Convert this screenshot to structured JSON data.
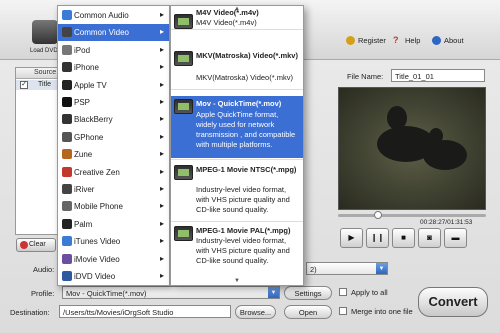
{
  "toolbar": {
    "load_label": "Load DVD",
    "register_label": "Register",
    "help_label": "Help",
    "about_label": "About"
  },
  "file_list": {
    "column_source": "Source",
    "row_title": "Title"
  },
  "clear_label": "Clear",
  "preview": {
    "file_name_label": "File Name:",
    "file_name_value": "Title_01_01",
    "time": "00:28:27/01:31:53"
  },
  "form": {
    "audio_label": "Audio:",
    "audio_value_partial": "2)",
    "profile_label": "Profile:",
    "profile_value": "Mov - QuickTime(*.mov)",
    "settings_label": "Settings",
    "apply_all_label": "Apply to all",
    "destination_label": "Destination:",
    "destination_value": "/Users/tts/Movies/iOrgSoft Studio",
    "browse_label": "Browse...",
    "open_label": "Open",
    "merge_label": "Merge into one file",
    "convert_label": "Convert"
  },
  "categories": [
    {
      "label": "Common Audio",
      "icon": "music-note-icon",
      "color": "#3a7bd5"
    },
    {
      "label": "Common Video",
      "icon": "film-icon",
      "color": "#444444",
      "selected": true
    },
    {
      "label": "iPod",
      "icon": "ipod-icon",
      "color": "#777777"
    },
    {
      "label": "iPhone",
      "icon": "iphone-icon",
      "color": "#333333"
    },
    {
      "label": "Apple TV",
      "icon": "apple-tv-icon",
      "color": "#222222"
    },
    {
      "label": "PSP",
      "icon": "psp-icon",
      "color": "#111111"
    },
    {
      "label": "BlackBerry",
      "icon": "blackberry-icon",
      "color": "#333333"
    },
    {
      "label": "GPhone",
      "icon": "gphone-icon",
      "color": "#555555"
    },
    {
      "label": "Zune",
      "icon": "zune-icon",
      "color": "#b5651d"
    },
    {
      "label": "Creative Zen",
      "icon": "creative-zen-icon",
      "color": "#c0392b"
    },
    {
      "label": "iRiver",
      "icon": "iriver-icon",
      "color": "#444444"
    },
    {
      "label": "Mobile Phone",
      "icon": "mobile-phone-icon",
      "color": "#666666"
    },
    {
      "label": "Palm",
      "icon": "palm-icon",
      "color": "#222222"
    },
    {
      "label": "iTunes Video",
      "icon": "itunes-icon",
      "color": "#3a7bd5"
    },
    {
      "label": "iMovie Video",
      "icon": "imovie-icon",
      "color": "#6a4fa0"
    },
    {
      "label": "iDVD Video",
      "icon": "idvd-icon",
      "color": "#2c5aa0"
    }
  ],
  "formats": [
    {
      "title": "M4V Video(*.m4v)",
      "lines": [
        "M4V Video(*.m4v)"
      ]
    },
    {
      "title": "MKV(Matroska) Video(*.mkv)",
      "lines": [
        "MKV(Matroska) Video(*.mkv)"
      ]
    },
    {
      "title": "Mov - QuickTime(*.mov)",
      "lines": [
        "Apple QuickTime format,",
        "widely used for network",
        "transmission , and compatible",
        "with multiple platforms."
      ],
      "selected": true
    },
    {
      "title": "MPEG-1 Movie NTSC(*.mpg)",
      "lines": [
        "Industry-level video format,",
        "with VHS picture quality and",
        "CD-like sound quality."
      ]
    },
    {
      "title": "MPEG-1 Movie PAL(*.mpg)",
      "lines": [
        "Industry-level video format,",
        "with VHS picture quality and",
        "CD-like sound quality."
      ]
    }
  ]
}
